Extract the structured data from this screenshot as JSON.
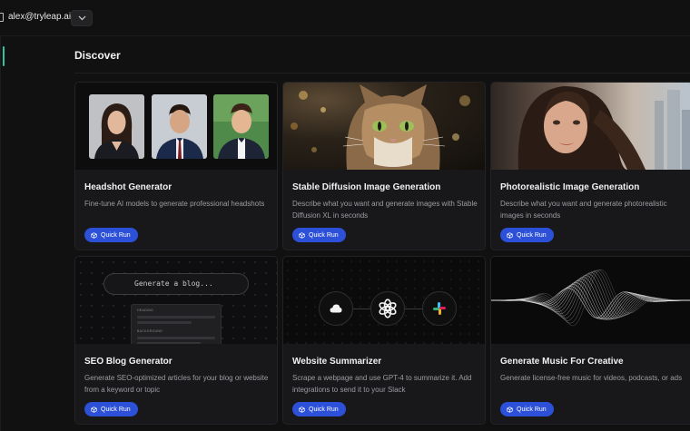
{
  "header": {
    "user_email": "alex@tryleap.ai"
  },
  "page": {
    "title": "Discover"
  },
  "cards": [
    {
      "title": "Headshot Generator",
      "description": "Fine-tune AI models to generate professional headshots",
      "button_label": "Quick Run",
      "thumbnail": "headshot-portraits"
    },
    {
      "title": "Stable Diffusion Image Generation",
      "description": "Describe what you want and generate images with Stable Diffusion XL in seconds",
      "button_label": "Quick Run",
      "thumbnail": "cat-photo"
    },
    {
      "title": "Photorealistic Image Generation",
      "description": "Describe what you want and generate photorealistic images in seconds",
      "button_label": "Quick Run",
      "thumbnail": "woman-portrait"
    },
    {
      "title": "SEO Blog Generator",
      "description": "Generate SEO-optimized articles for your blog or website from a keyword or topic",
      "button_label": "Quick Run",
      "thumbnail": "blog-input-mockup",
      "thumb_input_text": "Generate a blog...",
      "thumb_label_1": "HEADING",
      "thumb_label_2": "BACKGROUND"
    },
    {
      "title": "Website Summarizer",
      "description": "Scrape a webpage and use GPT-4 to summarize it. Add integrations to send it to your Slack",
      "button_label": "Quick Run",
      "thumbnail": "cloud-openai-slack-icons"
    },
    {
      "title": "Generate Music For Creative",
      "description": "Generate license-free music for videos, podcasts, or ads",
      "button_label": "Quick Run",
      "thumbnail": "sound-wave"
    }
  ],
  "colors": {
    "background": "#111112",
    "card": "#18181a",
    "accent_button": "#2c50d8",
    "active_indicator": "#2fc4a1"
  },
  "icons": [
    "user-icon",
    "chevron-down-icon",
    "cube-icon",
    "cloud-icon",
    "openai-icon",
    "slack-icon"
  ]
}
